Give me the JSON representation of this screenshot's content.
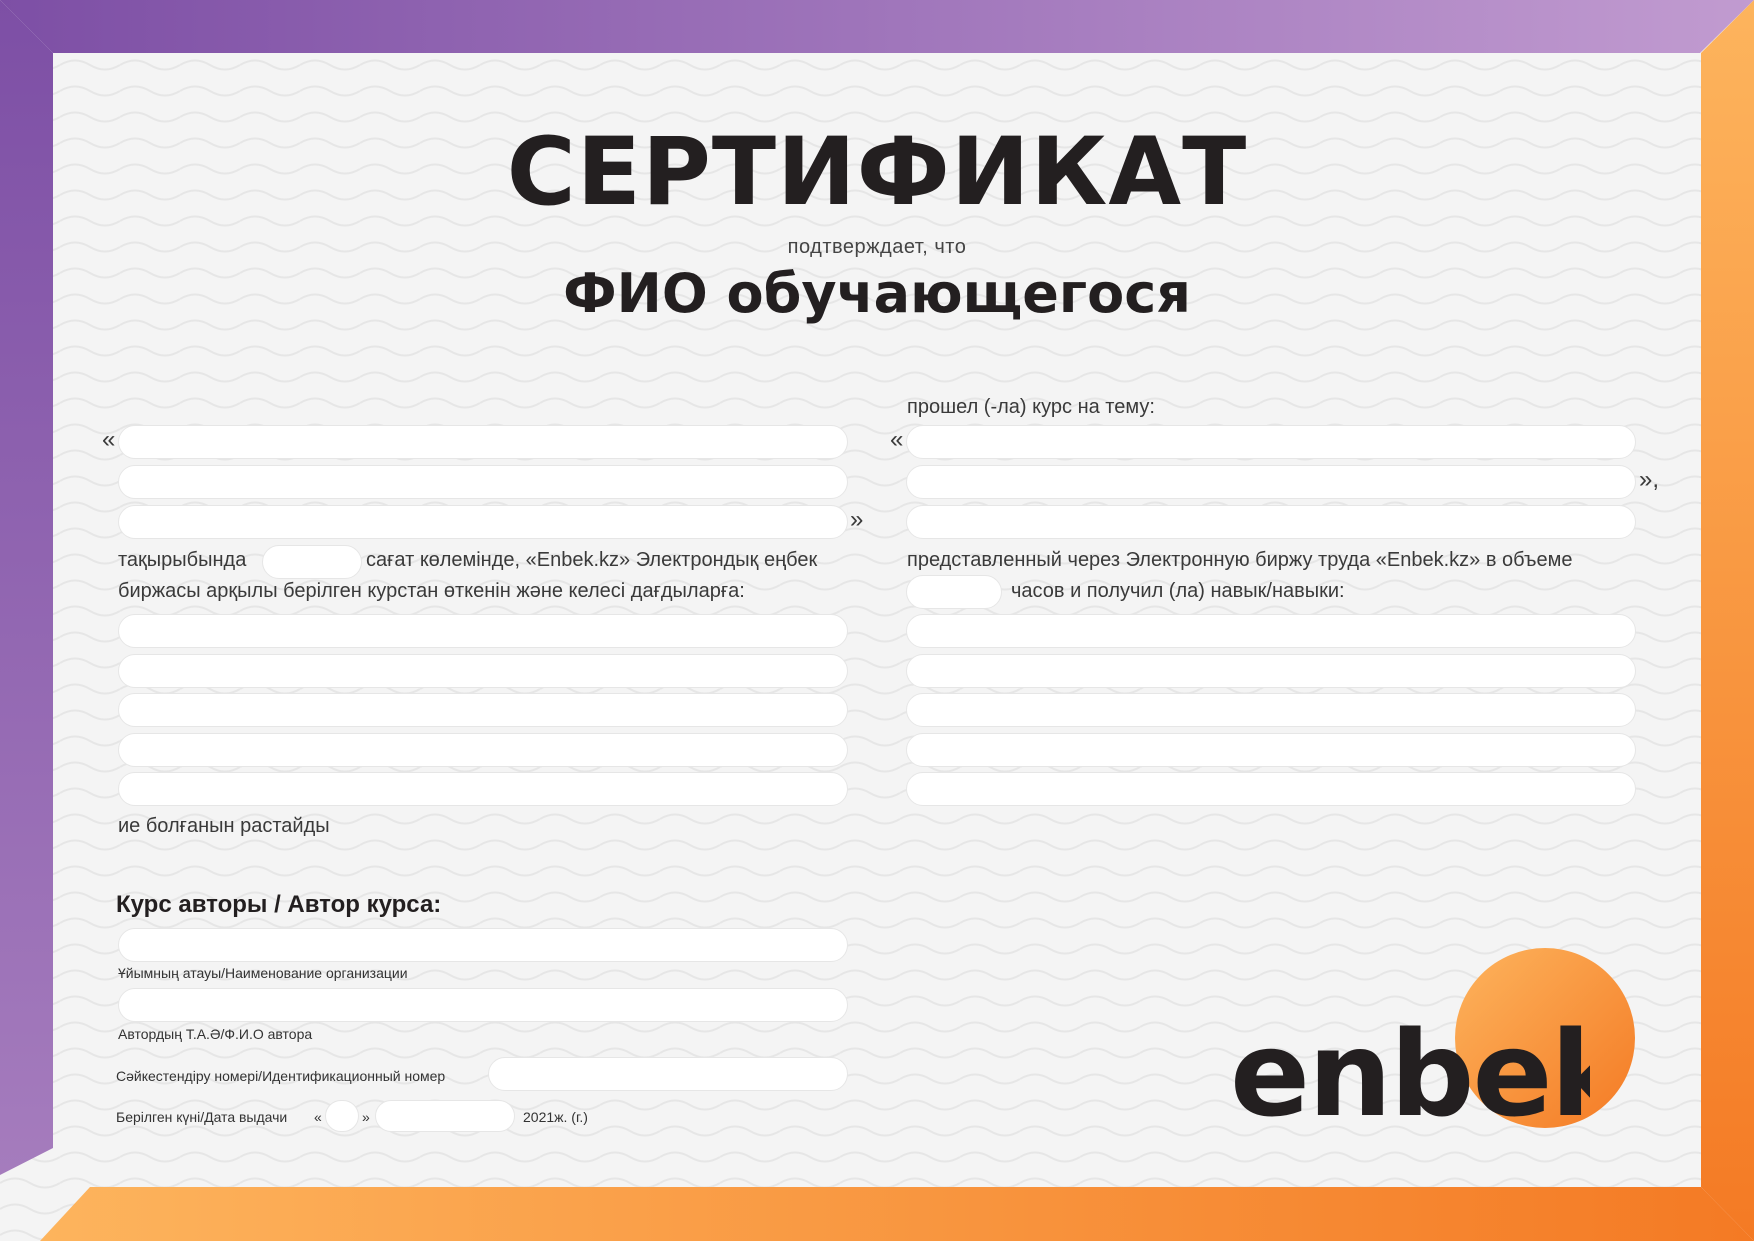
{
  "certificate": {
    "title": "СЕРТИФИКАТ",
    "subtitle": "подтверждает, что",
    "student_name": "ФИО обучающегося"
  },
  "quotes": {
    "open": "«",
    "close": "»",
    "close_comma": "»,"
  },
  "kazakh": {
    "topic_suffix": "тақырыбында",
    "hours_text": "сағат көлемінде, «Enbek.kz» Электрондық еңбек",
    "line2": "биржасы арқылы берілген курстан өткенін және келесі дағдыларға:",
    "ending": "ие болғанын растайды"
  },
  "russian": {
    "intro": "прошел (-ла) курс на тему:",
    "line1": "представленный через Электронную биржу труда «Enbek.kz» в объеме",
    "line2": "часов и получил (ла) навык/навыки:"
  },
  "author": {
    "heading": "Курс авторы / Автор курса:",
    "org_label": "Ұйымның атауы/Наименование организации",
    "author_label": "Автордың Т.А.Ә/Ф.И.О автора",
    "id_label": "Сәйкестендіру номері/Идентификационный номер",
    "date_label": "Берілген күні/Дата выдачи",
    "year_suffix": "2021ж. (г.)"
  },
  "logo": {
    "text": "enbek",
    "icon": "enbek-logo-icon"
  },
  "colors": {
    "purple": "#7d4fa5",
    "light_purple": "#b58dc4",
    "orange": "#f47a24",
    "light_orange": "#fdb45d",
    "paper": "#f4f4f4",
    "ink": "#231f20"
  }
}
